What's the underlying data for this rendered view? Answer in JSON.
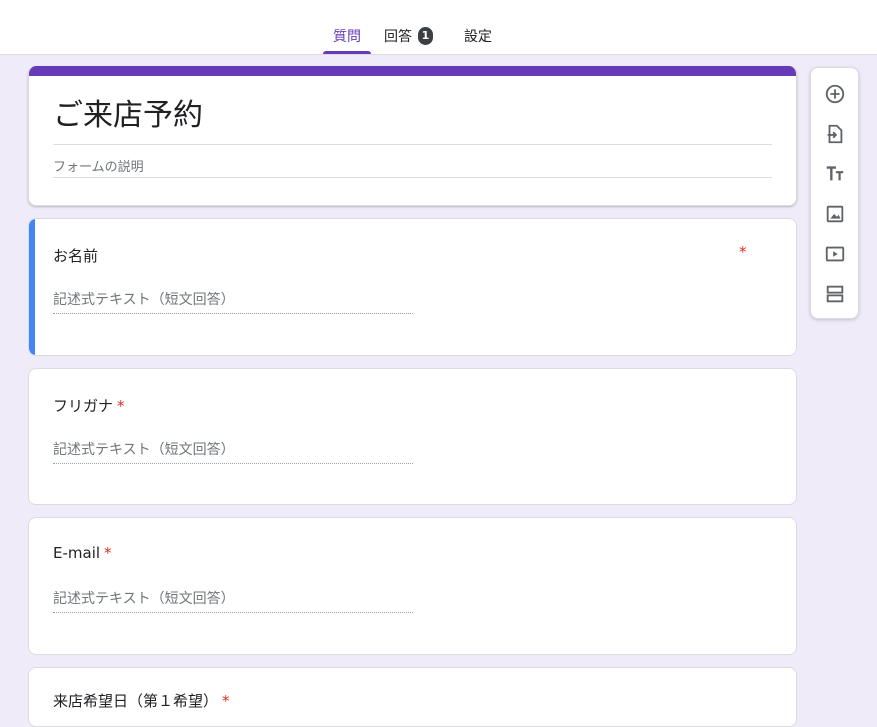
{
  "tabs": [
    {
      "label": "質問",
      "active": true
    },
    {
      "label": "回答",
      "badge": "1"
    },
    {
      "label": "設定"
    }
  ],
  "form": {
    "title": "ご来店予約",
    "description_placeholder": "フォームの説明",
    "accent_color": "#673ab7",
    "active_marker_color": "#4285f4"
  },
  "questions": [
    {
      "title": "お名前",
      "required_mark": "*",
      "answer_placeholder": "記述式テキスト（短文回答）"
    },
    {
      "title": "フリガナ",
      "required_mark": "*",
      "answer_placeholder": "記述式テキスト（短文回答）"
    },
    {
      "title": "E-mail",
      "required_mark": "*",
      "answer_placeholder": "記述式テキスト（短文回答）"
    },
    {
      "title": "来店希望日（第１希望）",
      "required_mark": "*"
    }
  ],
  "toolbar": {
    "icons": [
      "add-question-icon",
      "import-questions-icon",
      "add-title-icon",
      "add-image-icon",
      "add-video-icon",
      "add-section-icon"
    ]
  }
}
